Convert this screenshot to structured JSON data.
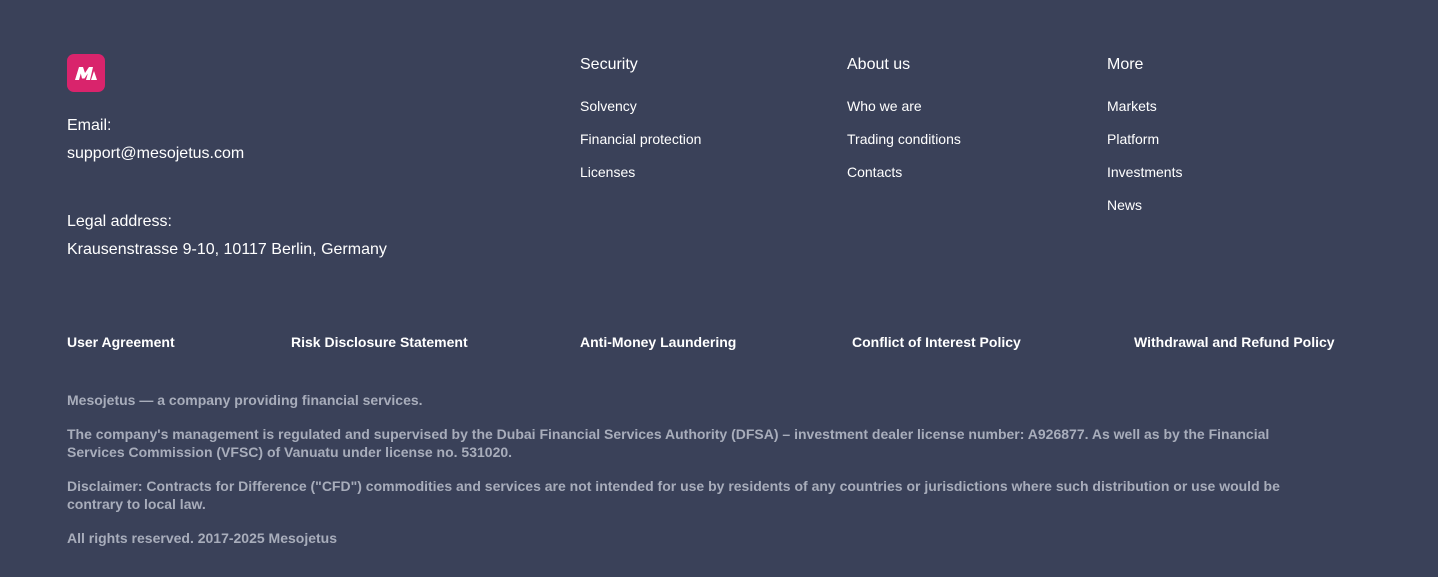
{
  "brand": {
    "logo_icon": "mesojetus-logo-icon",
    "logo_color": "#d9246c",
    "background_color": "#3a4159"
  },
  "contact": {
    "email_label": "Email:",
    "email_value": "support@mesojetus.com",
    "address_label": "Legal address:",
    "address_value": "Krausenstrasse 9-10, 10117 Berlin, Germany"
  },
  "columns": [
    {
      "title": "Security",
      "links": [
        "Solvency",
        "Financial protection",
        "Licenses"
      ]
    },
    {
      "title": "About us",
      "links": [
        "Who we are",
        "Trading conditions",
        "Contacts"
      ]
    },
    {
      "title": "More",
      "links": [
        "Markets",
        "Platform",
        "Investments",
        "News"
      ]
    }
  ],
  "legal_links": [
    "User Agreement",
    "Risk Disclosure Statement",
    "Anti-Money Laundering",
    "Conflict of Interest Policy",
    "Withdrawal and Refund Policy"
  ],
  "info": {
    "company": "Mesojetus — a company providing financial services.",
    "regulation": "The company's management is regulated and supervised by the Dubai Financial Services Authority (DFSA) – investment dealer license number: A926877. As well as by the Financial Services Commission (VFSC) of Vanuatu under license no. 531020.",
    "disclaimer": "Disclaimer: Contracts for Difference (\"CFD\") commodities and services are not intended for use by residents of any countries or jurisdictions where such distribution or use would be contrary to local law.",
    "copyright": "All rights reserved. 2017-2025 Mesojetus"
  }
}
